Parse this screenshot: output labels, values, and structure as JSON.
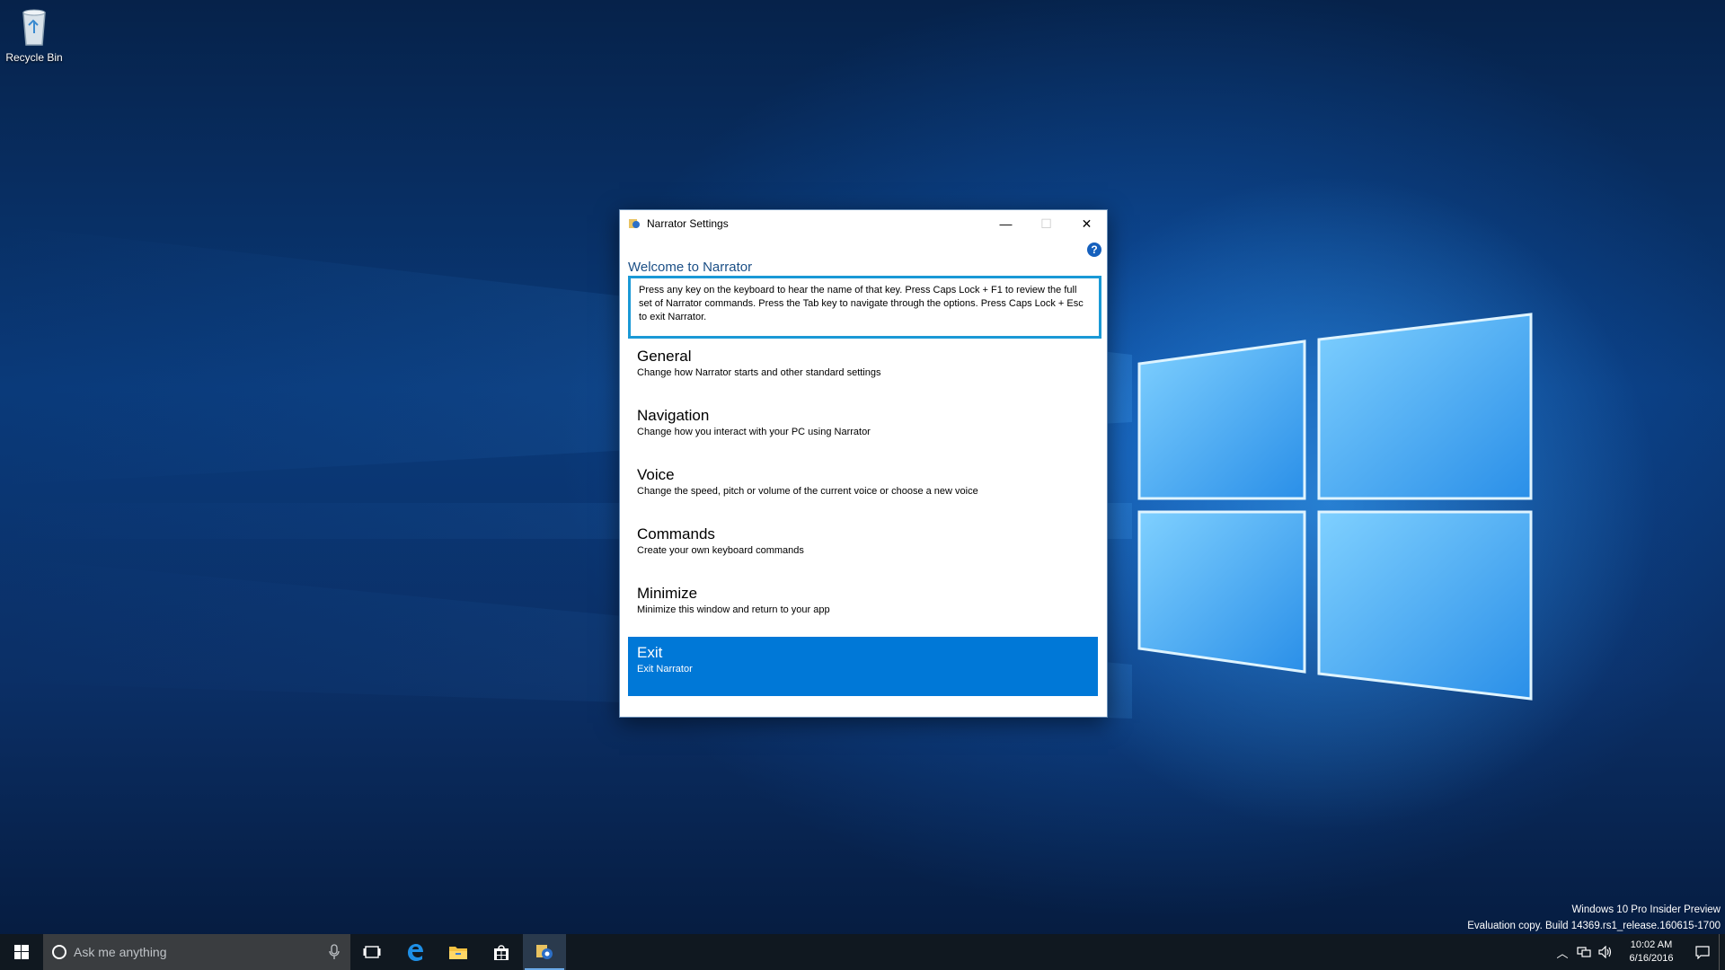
{
  "desktop": {
    "icons": [
      {
        "label": "Recycle Bin",
        "icon": "recycle-bin-icon"
      }
    ]
  },
  "window": {
    "title": "Narrator Settings",
    "app_icon": "narrator-icon",
    "controls": {
      "minimize": "—",
      "maximize": "☐",
      "close": "✕"
    },
    "help": "?",
    "welcome": "Welcome to Narrator",
    "intro": "Press any key on the keyboard to hear the name of that key.  Press Caps Lock + F1 to review the full set of Narrator commands.  Press the Tab key to navigate through the options.  Press Caps Lock + Esc to exit Narrator.",
    "menu": [
      {
        "heading": "General",
        "description": "Change how Narrator starts and other standard settings"
      },
      {
        "heading": "Navigation",
        "description": "Change how you interact with your PC using Narrator"
      },
      {
        "heading": "Voice",
        "description": "Change the speed, pitch or volume of the current voice or choose a new voice"
      },
      {
        "heading": "Commands",
        "description": "Create your own keyboard commands"
      },
      {
        "heading": "Minimize",
        "description": "Minimize this window and return to your app"
      },
      {
        "heading": "Exit",
        "description": "Exit Narrator",
        "selected": true
      }
    ],
    "accent": "#0078d7"
  },
  "watermark": {
    "line1": "Windows 10 Pro Insider Preview",
    "line2": "Evaluation copy. Build 14369.rs1_release.160615-1700"
  },
  "taskbar": {
    "search_placeholder": "Ask me anything",
    "pinned": [
      "task-view-icon",
      "edge-icon",
      "file-explorer-icon",
      "store-icon",
      "narrator-icon"
    ],
    "clock_time": "10:02 AM",
    "clock_date": "6/16/2016"
  }
}
